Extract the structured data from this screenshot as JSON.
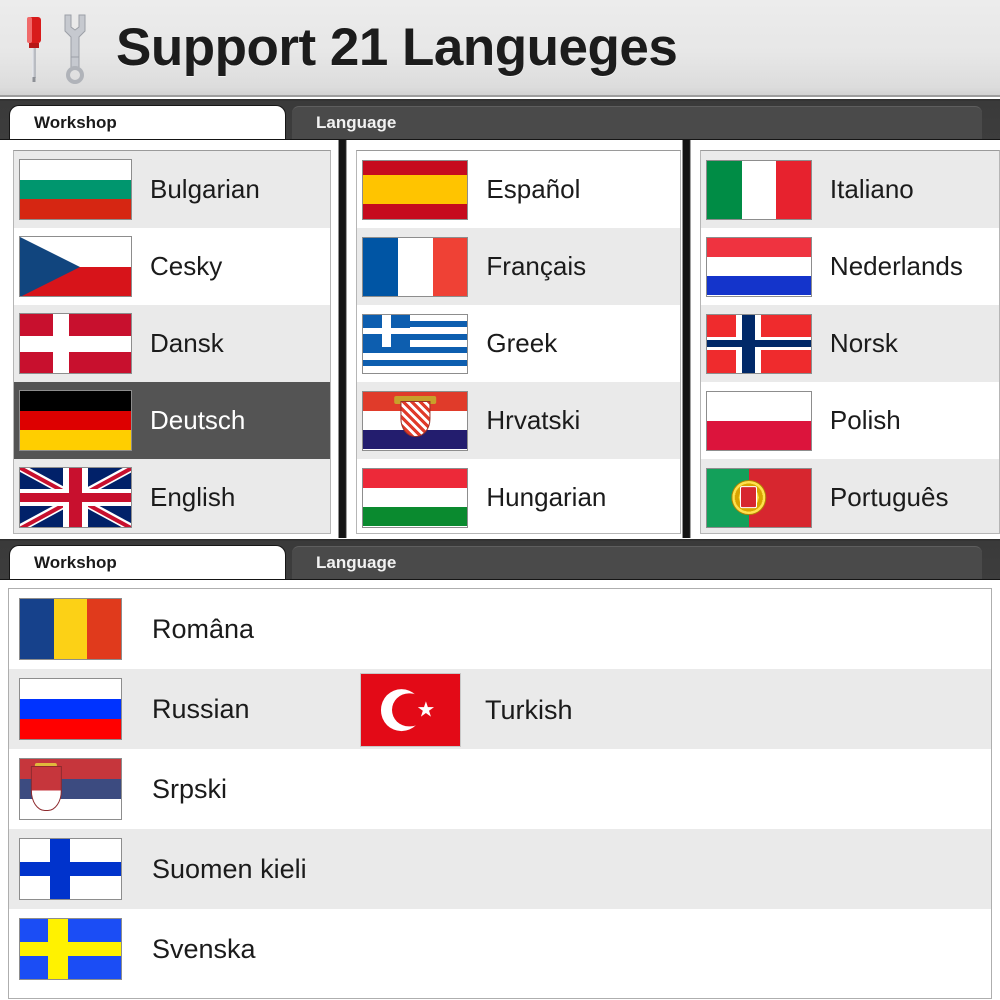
{
  "header": {
    "title": "Support 21 Langueges",
    "icons": [
      "screwdriver-icon",
      "wrench-icon"
    ]
  },
  "colors": {
    "header_bg": "#ececec",
    "tabstrip_bg": "#3d3d3d",
    "tab_active_bg": "#ffffff",
    "tab_inactive_bg": "#4a4a4a",
    "row_alt": "#eaeaea",
    "row_base": "#ffffff",
    "row_selected": "#545454",
    "row_selected_text": "#ffffff",
    "text": "#1b1b1b"
  },
  "panel_top": {
    "tabs": [
      {
        "label": "Workshop",
        "active": true
      },
      {
        "label": "Language",
        "active": false
      }
    ],
    "columns": [
      {
        "name": "language-column-1",
        "items": [
          {
            "label": "Bulgarian",
            "flag": "bulgaria-flag",
            "flag_class": "f-bg",
            "shade": "alt-a",
            "selected": false
          },
          {
            "label": "Cesky",
            "flag": "czech-flag",
            "flag_class": "f-cz",
            "shade": "alt-b",
            "selected": false
          },
          {
            "label": "Dansk",
            "flag": "denmark-flag",
            "flag_class": "f-dk",
            "shade": "alt-a",
            "selected": false
          },
          {
            "label": "Deutsch",
            "flag": "germany-flag",
            "flag_class": "f-de",
            "shade": "alt-b",
            "selected": true
          },
          {
            "label": "English",
            "flag": "uk-flag",
            "flag_class": "f-gb",
            "shade": "alt-a",
            "selected": false
          }
        ]
      },
      {
        "name": "language-column-2",
        "items": [
          {
            "label": "Español",
            "flag": "spain-flag",
            "flag_class": "f-es",
            "shade": "alt-b",
            "selected": false
          },
          {
            "label": "Français",
            "flag": "france-flag",
            "flag_class": "f-fr",
            "shade": "alt-a",
            "selected": false
          },
          {
            "label": "Greek",
            "flag": "greece-flag",
            "flag_class": "f-gr",
            "shade": "alt-b",
            "selected": false
          },
          {
            "label": "Hrvatski",
            "flag": "croatia-flag",
            "flag_class": "f-hr",
            "shade": "alt-a",
            "selected": false
          },
          {
            "label": "Hungarian",
            "flag": "hungary-flag",
            "flag_class": "f-hu",
            "shade": "alt-b",
            "selected": false
          }
        ]
      },
      {
        "name": "language-column-3",
        "items": [
          {
            "label": "Italiano",
            "flag": "italy-flag",
            "flag_class": "f-it",
            "shade": "alt-a",
            "selected": false
          },
          {
            "label": "Nederlands",
            "flag": "netherlands-flag",
            "flag_class": "f-nl",
            "shade": "alt-b",
            "selected": false
          },
          {
            "label": "Norsk",
            "flag": "norway-flag",
            "flag_class": "f-no",
            "shade": "alt-a",
            "selected": false
          },
          {
            "label": "Polish",
            "flag": "poland-flag",
            "flag_class": "f-pl",
            "shade": "alt-b",
            "selected": false
          },
          {
            "label": "Português",
            "flag": "portugal-flag",
            "flag_class": "f-pt",
            "shade": "alt-a",
            "selected": false
          }
        ]
      }
    ]
  },
  "panel_bottom": {
    "tabs": [
      {
        "label": "Workshop",
        "active": true
      },
      {
        "label": "Language",
        "active": false
      }
    ],
    "items": [
      {
        "label": "Româna",
        "flag": "romania-flag",
        "flag_class": "f-ro",
        "shade": "alt-b",
        "selected": false
      },
      {
        "label": "Russian",
        "flag": "russia-flag",
        "flag_class": "f-ru",
        "shade": "alt-a",
        "selected": false
      },
      {
        "label": "Srpski",
        "flag": "serbia-flag",
        "flag_class": "f-rs",
        "shade": "alt-b",
        "selected": false
      },
      {
        "label": "Suomen kieli",
        "flag": "finland-flag",
        "flag_class": "f-fi",
        "shade": "alt-a",
        "selected": false
      },
      {
        "label": "Svenska",
        "flag": "sweden-flag",
        "flag_class": "f-se",
        "shade": "alt-b",
        "selected": false
      }
    ],
    "overlay": {
      "label": "Turkish",
      "flag": "turkey-flag",
      "flag_class": "f-tr"
    }
  },
  "total_languages": 21
}
